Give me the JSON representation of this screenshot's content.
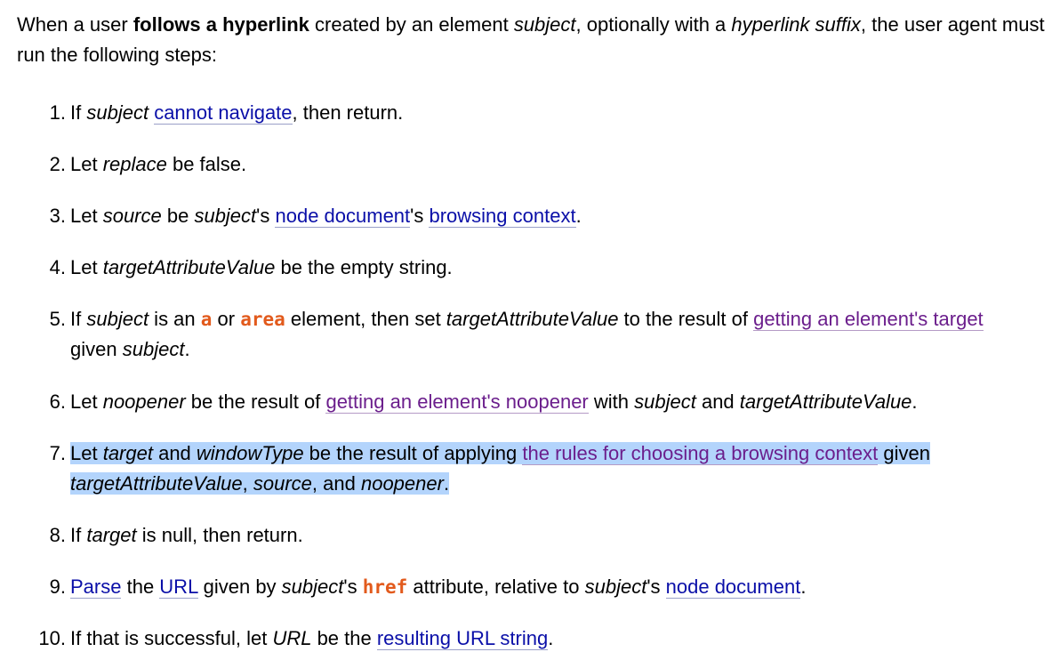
{
  "intro": {
    "t1": "When a user ",
    "strong": "follows a hyperlink",
    "t2": " created by an element ",
    "em1": "subject",
    "t3": ", optionally with a ",
    "em2": "hyperlink suffix",
    "t4": ", the user agent must run the following steps:"
  },
  "steps": {
    "s1": {
      "num": "1.",
      "a": "If ",
      "b": "subject",
      "c": " ",
      "link1": "cannot navigate",
      "d": ", then return."
    },
    "s2": {
      "num": "2.",
      "a": "Let ",
      "b": "replace",
      "c": " be false."
    },
    "s3": {
      "num": "3.",
      "a": "Let ",
      "b": "source",
      "c": " be ",
      "d": "subject",
      "e": "'s ",
      "link1": "node document",
      "f": "'s ",
      "link2": "browsing context",
      "g": "."
    },
    "s4": {
      "num": "4.",
      "a": "Let ",
      "b": "targetAttributeValue",
      "c": " be the empty string."
    },
    "s5": {
      "num": "5.",
      "a": "If ",
      "b": "subject",
      "c": " is an ",
      "code1": "a",
      "d": " or ",
      "code2": "area",
      "e": " element, then set ",
      "f": "targetAttributeValue",
      "g": " to the result of ",
      "link1": "getting an element's target",
      "h": " given ",
      "i": "subject",
      "j": "."
    },
    "s6": {
      "num": "6.",
      "a": "Let ",
      "b": "noopener",
      "c": " be the result of ",
      "link1": "getting an element's noopener",
      "d": " with ",
      "e": "subject",
      "f": " and ",
      "g": "targetAttributeValue",
      "h": "."
    },
    "s7": {
      "num": "7.",
      "a": "Let ",
      "b": "target",
      "c": " and ",
      "d": "windowType",
      "e": " be the result of applying ",
      "link1": "the rules for choosing a browsing context",
      "f": " given ",
      "g": "targetAttributeValue",
      "h": ", ",
      "i": "source",
      "j": ", and ",
      "k": "noopener",
      "l": "."
    },
    "s8": {
      "num": "8.",
      "a": "If ",
      "b": "target",
      "c": " is null, then return."
    },
    "s9": {
      "num": "9.",
      "link1": "Parse",
      "a": " the ",
      "link2": "URL",
      "b": " given by ",
      "c": "subject",
      "d": "'s ",
      "code1": "href",
      "e": " attribute, relative to ",
      "f": "subject",
      "g": "'s ",
      "link3": "node document",
      "h": "."
    },
    "s10": {
      "num": "10.",
      "a": "If that is successful, let ",
      "b": "URL",
      "c": " be the ",
      "link1": "resulting URL string",
      "d": "."
    }
  }
}
